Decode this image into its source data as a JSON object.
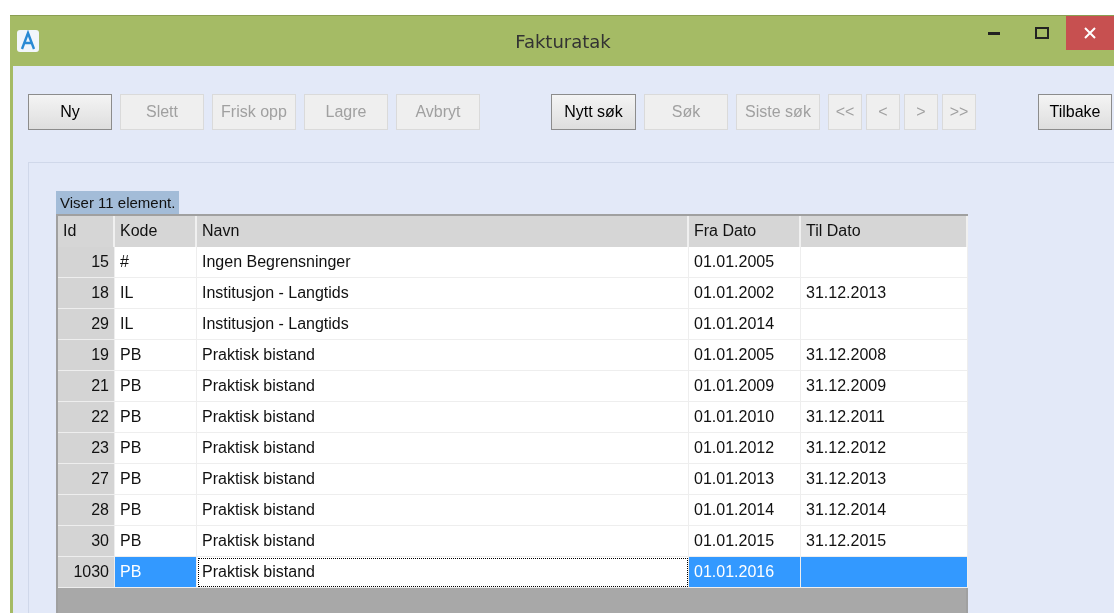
{
  "window": {
    "title": "Fakturatak"
  },
  "toolbar": {
    "left": [
      {
        "label": "Ny",
        "disabled": false
      },
      {
        "label": "Slett",
        "disabled": true
      },
      {
        "label": "Frisk opp",
        "disabled": true
      },
      {
        "label": "Lagre",
        "disabled": true
      },
      {
        "label": "Avbryt",
        "disabled": true
      }
    ],
    "search": [
      {
        "label": "Nytt søk",
        "disabled": false
      },
      {
        "label": "Søk",
        "disabled": true
      },
      {
        "label": "Siste søk",
        "disabled": true
      }
    ],
    "nav": [
      {
        "label": "<<",
        "disabled": true
      },
      {
        "label": "<",
        "disabled": true
      },
      {
        "label": ">",
        "disabled": true
      },
      {
        "label": ">>",
        "disabled": true
      }
    ],
    "right": [
      {
        "label": "Tilbake",
        "disabled": false
      }
    ]
  },
  "status": "Viser 11 element.",
  "table": {
    "columns": [
      "Id",
      "Kode",
      "Navn",
      "Fra Dato",
      "Til Dato"
    ],
    "rows": [
      {
        "id": "15",
        "kode": "#",
        "navn": "Ingen Begrensninger",
        "fra": "01.01.2005",
        "til": "",
        "selected": false
      },
      {
        "id": "18",
        "kode": "IL",
        "navn": "Institusjon - Langtids",
        "fra": "01.01.2002",
        "til": "31.12.2013",
        "selected": false
      },
      {
        "id": "29",
        "kode": "IL",
        "navn": "Institusjon - Langtids",
        "fra": "01.01.2014",
        "til": "",
        "selected": false
      },
      {
        "id": "19",
        "kode": "PB",
        "navn": "Praktisk bistand",
        "fra": "01.01.2005",
        "til": "31.12.2008",
        "selected": false
      },
      {
        "id": "21",
        "kode": "PB",
        "navn": "Praktisk bistand",
        "fra": "01.01.2009",
        "til": "31.12.2009",
        "selected": false
      },
      {
        "id": "22",
        "kode": "PB",
        "navn": "Praktisk bistand",
        "fra": "01.01.2010",
        "til": "31.12.2011",
        "selected": false
      },
      {
        "id": "23",
        "kode": "PB",
        "navn": "Praktisk bistand",
        "fra": "01.01.2012",
        "til": "31.12.2012",
        "selected": false
      },
      {
        "id": "27",
        "kode": "PB",
        "navn": "Praktisk bistand",
        "fra": "01.01.2013",
        "til": "31.12.2013",
        "selected": false
      },
      {
        "id": "28",
        "kode": "PB",
        "navn": "Praktisk bistand",
        "fra": "01.01.2014",
        "til": "31.12.2014",
        "selected": false
      },
      {
        "id": "30",
        "kode": "PB",
        "navn": "Praktisk bistand",
        "fra": "01.01.2015",
        "til": "31.12.2015",
        "selected": false
      },
      {
        "id": "1030",
        "kode": "PB",
        "navn": "Praktisk bistand",
        "fra": "01.01.2016",
        "til": "",
        "selected": true
      }
    ]
  }
}
